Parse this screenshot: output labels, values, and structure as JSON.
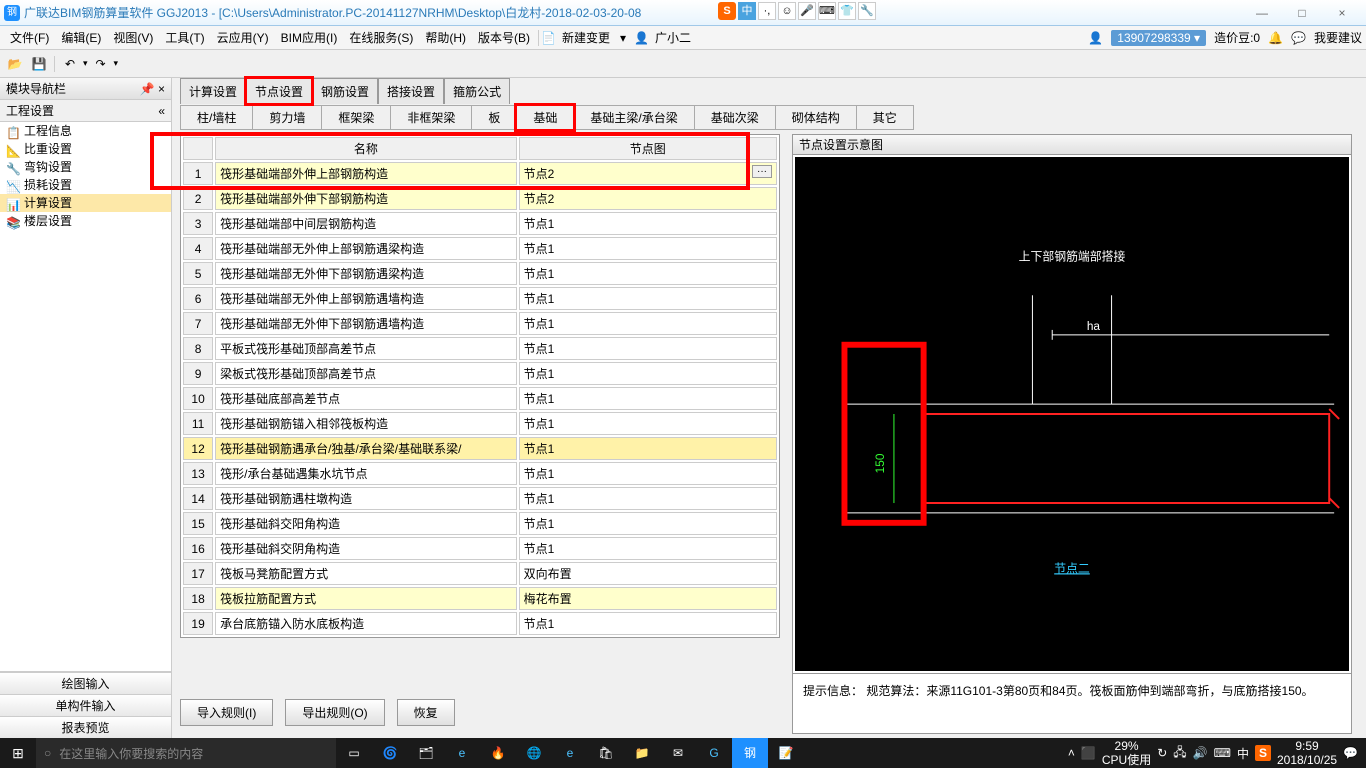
{
  "title": "广联达BIM钢筋算量软件 GGJ2013 - [C:\\Users\\Administrator.PC-20141127NRHM\\Desktop\\白龙村-2018-02-03-20-08",
  "menu": [
    "文件(F)",
    "编辑(E)",
    "视图(V)",
    "工具(T)",
    "云应用(Y)",
    "BIM应用(I)",
    "在线服务(S)",
    "帮助(H)",
    "版本号(B)"
  ],
  "menu_extra": {
    "new_change": "新建变更",
    "user": "广小二"
  },
  "menu_right": {
    "phone": "13907298339",
    "coin_label": "造价豆:0",
    "suggest": "我要建议"
  },
  "left_panel": {
    "title": "模块导航栏",
    "sub": "工程设置",
    "items": [
      {
        "icon": "📋",
        "label": "工程信息"
      },
      {
        "icon": "📐",
        "label": "比重设置"
      },
      {
        "icon": "🔧",
        "label": "弯钩设置"
      },
      {
        "icon": "📉",
        "label": "损耗设置"
      },
      {
        "icon": "📊",
        "label": "计算设置",
        "selected": true
      },
      {
        "icon": "📚",
        "label": "楼层设置"
      }
    ],
    "buttons": [
      "绘图输入",
      "单构件输入",
      "报表预览"
    ]
  },
  "settings_tabs": [
    "计算设置",
    "节点设置",
    "钢筋设置",
    "搭接设置",
    "箍筋公式"
  ],
  "cat_tabs": [
    "柱/墙柱",
    "剪力墙",
    "框架梁",
    "非框架梁",
    "板",
    "基础",
    "基础主梁/承台梁",
    "基础次梁",
    "砌体结构",
    "其它"
  ],
  "table": {
    "cols": [
      "名称",
      "节点图"
    ],
    "rows": [
      {
        "n": 1,
        "name": "筏形基础端部外伸上部钢筋构造",
        "node": "节点2",
        "hl": true,
        "btn": true
      },
      {
        "n": 2,
        "name": "筏形基础端部外伸下部钢筋构造",
        "node": "节点2",
        "hl": true
      },
      {
        "n": 3,
        "name": "筏形基础端部中间层钢筋构造",
        "node": "节点1"
      },
      {
        "n": 4,
        "name": "筏形基础端部无外伸上部钢筋遇梁构造",
        "node": "节点1"
      },
      {
        "n": 5,
        "name": "筏形基础端部无外伸下部钢筋遇梁构造",
        "node": "节点1"
      },
      {
        "n": 6,
        "name": "筏形基础端部无外伸上部钢筋遇墙构造",
        "node": "节点1"
      },
      {
        "n": 7,
        "name": "筏形基础端部无外伸下部钢筋遇墙构造",
        "node": "节点1"
      },
      {
        "n": 8,
        "name": "平板式筏形基础顶部高差节点",
        "node": "节点1"
      },
      {
        "n": 9,
        "name": "梁板式筏形基础顶部高差节点",
        "node": "节点1"
      },
      {
        "n": 10,
        "name": "筏形基础底部高差节点",
        "node": "节点1"
      },
      {
        "n": 11,
        "name": "筏形基础钢筋锚入相邻筏板构造",
        "node": "节点1"
      },
      {
        "n": 12,
        "name": "筏形基础钢筋遇承台/独基/承台梁/基础联系梁/",
        "node": "节点1",
        "sel": true
      },
      {
        "n": 13,
        "name": "筏形/承台基础遇集水坑节点",
        "node": "节点1"
      },
      {
        "n": 14,
        "name": "筏形基础钢筋遇柱墩构造",
        "node": "节点1"
      },
      {
        "n": 15,
        "name": "筏形基础斜交阳角构造",
        "node": "节点1"
      },
      {
        "n": 16,
        "name": "筏形基础斜交阴角构造",
        "node": "节点1"
      },
      {
        "n": 17,
        "name": "筏板马凳筋配置方式",
        "node": "双向布置"
      },
      {
        "n": 18,
        "name": "筏板拉筋配置方式",
        "node": "梅花布置",
        "hl": true
      },
      {
        "n": 19,
        "name": "承台底筋锚入防水底板构造",
        "node": "节点1"
      }
    ]
  },
  "actions": {
    "import": "导入规则(I)",
    "export": "导出规则(O)",
    "restore": "恢复"
  },
  "diagram": {
    "header": "节点设置示意图",
    "title": "上下部钢筋端部搭接",
    "ha": "ha",
    "dim150": "150",
    "node_label": "节点二",
    "hint": "提示信息：   规范算法：来源11G101-3第80页和84页。筏板面筋伸到端部弯折，与底筋搭接150。"
  },
  "taskbar": {
    "search_ph": "在这里输入你要搜索的内容",
    "cpu_pct": "29%",
    "cpu_lbl": "CPU使用",
    "time": "9:59",
    "date": "2018/10/25"
  },
  "ime": {
    "s": "S",
    "zhong": "中"
  }
}
